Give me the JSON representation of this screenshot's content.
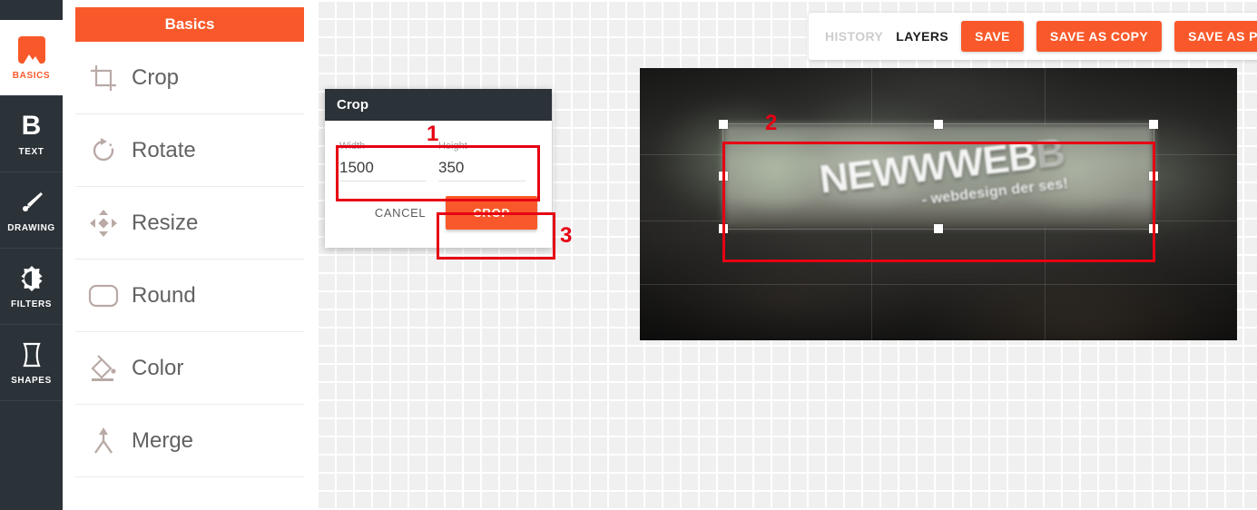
{
  "rail": {
    "items": [
      {
        "label": "BASICS",
        "icon": "image-icon",
        "active": true
      },
      {
        "label": "TEXT",
        "icon": "bold-b-icon",
        "active": false
      },
      {
        "label": "DRAWING",
        "icon": "brush-icon",
        "active": false
      },
      {
        "label": "FILTERS",
        "icon": "contrast-icon",
        "active": false
      },
      {
        "label": "SHAPES",
        "icon": "shape-icon",
        "active": false
      }
    ]
  },
  "panel": {
    "title": "Basics",
    "items": [
      {
        "label": "Crop",
        "icon": "crop-icon"
      },
      {
        "label": "Rotate",
        "icon": "rotate-icon"
      },
      {
        "label": "Resize",
        "icon": "resize-icon"
      },
      {
        "label": "Round",
        "icon": "round-icon"
      },
      {
        "label": "Color",
        "icon": "paint-bucket-icon"
      },
      {
        "label": "Merge",
        "icon": "merge-icon"
      }
    ]
  },
  "dialog": {
    "title": "Crop",
    "width_label": "Width",
    "width_value": "1500",
    "height_label": "Height",
    "height_value": "350",
    "cancel_label": "CANCEL",
    "crop_label": "CROP"
  },
  "toolbar": {
    "history_label": "HISTORY",
    "layers_label": "LAYERS",
    "save_label": "SAVE",
    "save_as_copy_label": "SAVE AS COPY",
    "save_as_png_label": "SAVE AS PNG"
  },
  "annotations": [
    {
      "number": "1"
    },
    {
      "number": "2"
    },
    {
      "number": "3"
    }
  ],
  "photo": {
    "logo_part_1": "NEWWW",
    "logo_part_2": "EB",
    "logo_part_3": "B",
    "tagline": "- webdesign der ses!"
  },
  "colors": {
    "accent": "#f9592a",
    "dark": "#2b3238",
    "annotation_red": "#e60013"
  }
}
